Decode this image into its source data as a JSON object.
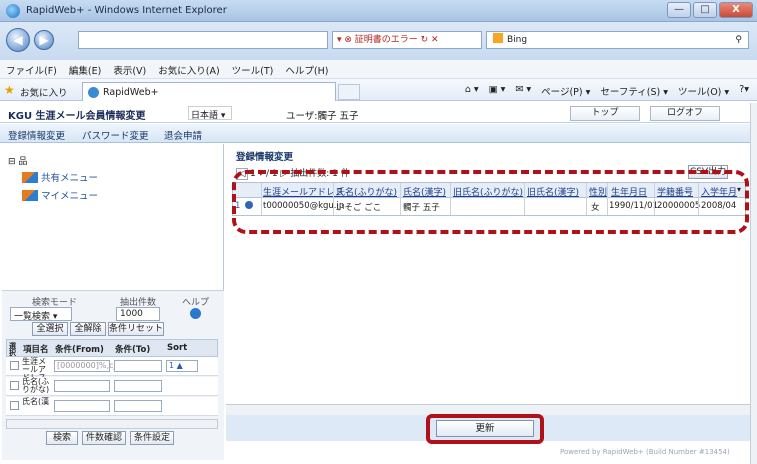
{
  "window": {
    "title": "RapidWeb+ - Windows Internet Explorer",
    "min": "—",
    "max": "□",
    "close": "X"
  },
  "addressbar": {
    "back": "◀",
    "forward": "▶",
    "cert_error": "▾ ⊗ 証明書のエラー  ↻  ✕",
    "search_engine": "Bing",
    "search_icon": "⚲"
  },
  "menu": [
    "ファイル(F)",
    "編集(E)",
    "表示(V)",
    "お気に入り(A)",
    "ツール(T)",
    "ヘルプ(H)"
  ],
  "favorites": {
    "label": "お気に入り",
    "tab": "RapidWeb+",
    "commands": [
      "⌂ ▾",
      "▣ ▾",
      "✉ ▾",
      "ページ(P) ▾",
      "セーフティ(S) ▾",
      "ツール(O) ▾",
      "?▾"
    ]
  },
  "app": {
    "title": "KGU 生涯メール会員情報変更",
    "language": "日本語 ▾",
    "user": "ユーザ:髑子 五子",
    "top_button": "トップ",
    "logoff_button": "ログオフ"
  },
  "subnav": [
    "登録情報変更",
    "パスワード変更",
    "退会申請"
  ],
  "tree": {
    "root": "⊟ 品",
    "items": [
      "共有メニュー",
      "マイメニュー"
    ]
  },
  "search": {
    "mode_label": "検索モード",
    "count_label": "抽出件数",
    "help_label": "ヘルプ",
    "mode_value": "一覧検索 ▾",
    "count_value": "1000",
    "select_all": "全選択",
    "deselect_all": "全解除",
    "reset": "条件リセット",
    "col_select": "選択",
    "col_item": "項目名",
    "col_from": "条件(From)",
    "col_to": "条件(To)",
    "col_sort": "Sort",
    "rows": [
      {
        "name": "生涯メールアドレス",
        "from": "[0000000]%,cj]",
        "sort": "1 ▲"
      },
      {
        "name": "氏名(ふりがな)",
        "from": "",
        "sort": ""
      },
      {
        "name": "氏名(漢",
        "from": "",
        "sort": ""
      }
    ],
    "btn_search": "検索",
    "btn_count": "件数確認",
    "btn_settings": "条件設定"
  },
  "main": {
    "title": "登録情報変更",
    "pager_text": "1 ▾ / 1 ▷ 抽出件数: 1 件",
    "csv": "CSV出力",
    "columns": [
      "生涯メールアドレス",
      "氏名(ふりがな)",
      "氏名(漢字)",
      "旧氏名(ふりがな)",
      "旧氏名(漢字)",
      "性別",
      "生年月日",
      "学籍番号",
      "入学年月"
    ],
    "row_num": "1",
    "row": [
      "t00000050@kgu.jp",
      "いそご ごこ",
      "髑子 五子",
      "",
      "",
      "女",
      "1990/11/01",
      "20000005",
      "2008/04"
    ],
    "update": "更新",
    "scroll_mark": "▾"
  },
  "footer": "Powered by RapidWeb+ (Build Number #13454)"
}
